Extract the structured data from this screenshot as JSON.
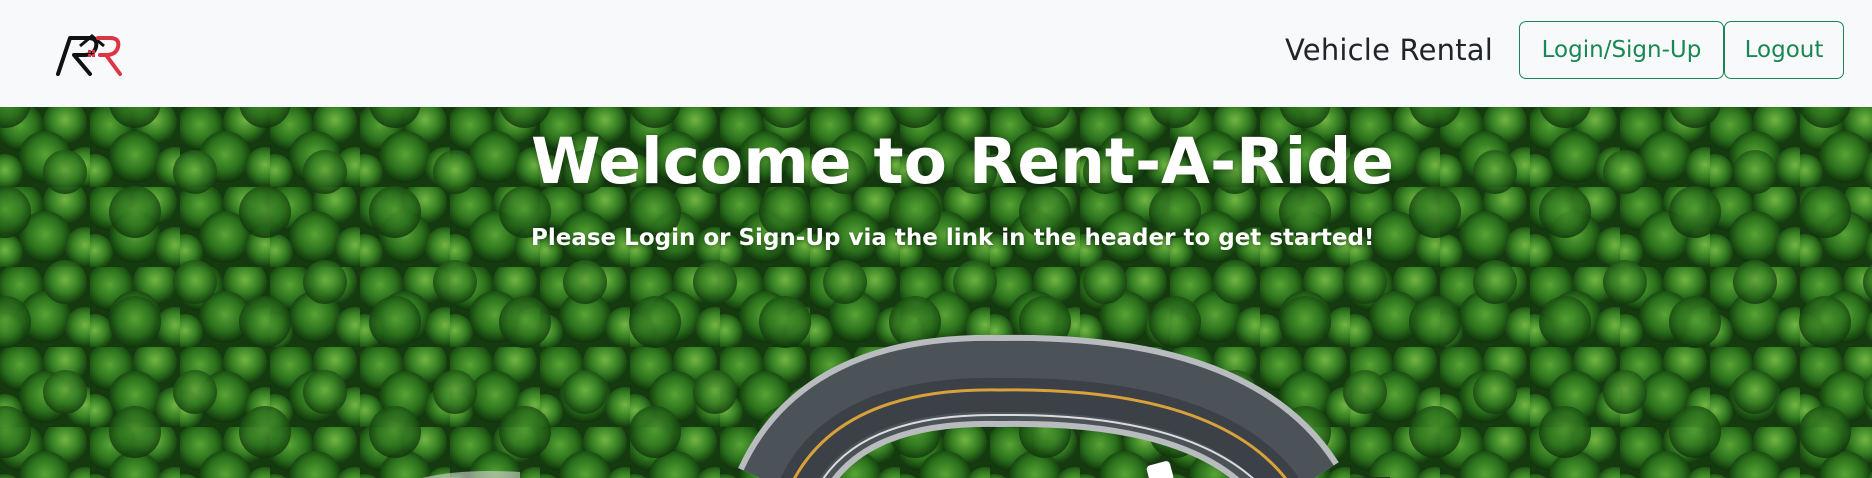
{
  "header": {
    "logo_icon": "rar-logo-icon",
    "title": "Vehicle Rental",
    "login_label": "Login/Sign-Up",
    "logout_label": "Logout"
  },
  "hero": {
    "title": "Welcome to Rent-A-Ride",
    "subtitle": "Please Login or Sign-Up via the link in the header to get started!",
    "background": "aerial-forest-road-image"
  },
  "colors": {
    "header_bg": "#f8f9fa",
    "button_outline": "#198754",
    "logo_accent": "#dc3545",
    "hero_text": "#ffffff"
  }
}
